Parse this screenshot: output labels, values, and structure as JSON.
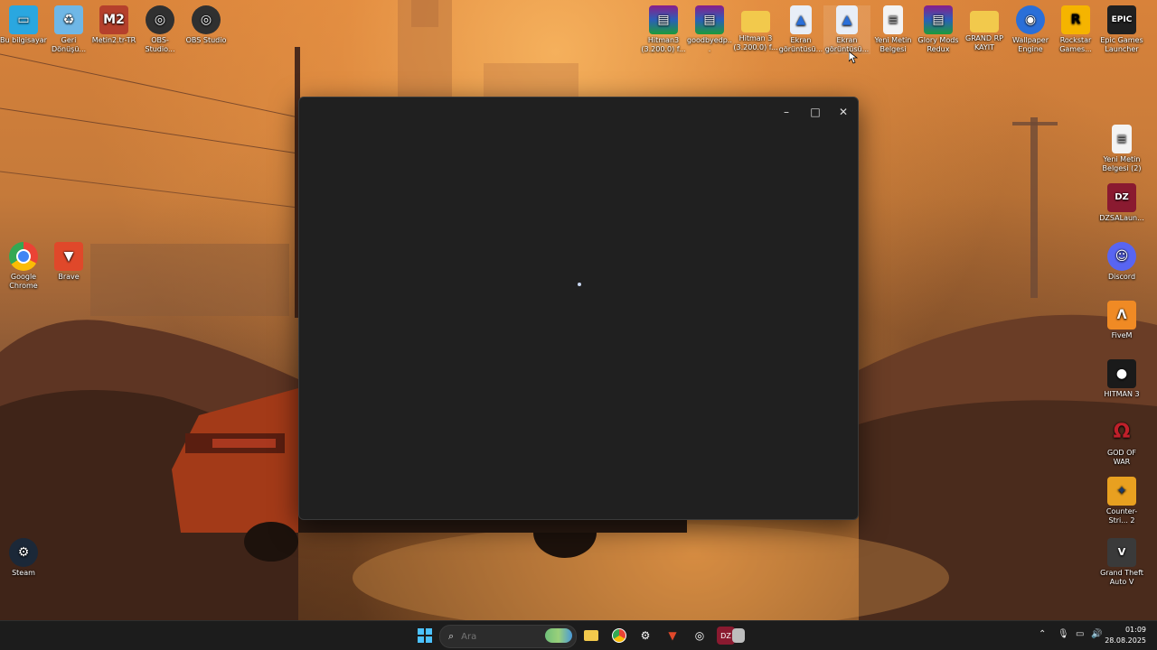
{
  "desktop": {
    "left_icons": [
      {
        "label": "Bu bilgisayar",
        "icon": "computer-icon",
        "color": "#2aa7e0"
      },
      {
        "label": "Geri Dönüşü...",
        "icon": "recycle-bin-icon",
        "color": "#6fb7e6"
      },
      {
        "label": "Metin2.tr-TR",
        "icon": "metin2-icon",
        "color": "#b5402c"
      },
      {
        "label": "OBS-Studio...",
        "icon": "obs-icon",
        "color": "#303030"
      },
      {
        "label": "OBS Studio",
        "icon": "obs-icon",
        "color": "#303030"
      },
      {
        "label": "Google Chrome",
        "icon": "chrome-icon",
        "color": "#ffffff"
      },
      {
        "label": "Brave",
        "icon": "brave-icon",
        "color": "#e0482a"
      },
      {
        "label": "Steam",
        "icon": "steam-icon",
        "color": "#1b2838"
      }
    ],
    "top_icons": [
      {
        "label": "Hitman3 (3.200.0) f...",
        "icon": "winrar-icon",
        "color": "#8a1e8a"
      },
      {
        "label": "goodbyedp...",
        "icon": "winrar-icon",
        "color": "#8a1e8a"
      },
      {
        "label": "Hitman 3 (3.200.0) f...",
        "icon": "folder-icon",
        "color": "#f2c94c"
      },
      {
        "label": "Ekran görüntüsü...",
        "icon": "image-file-icon",
        "color": "#e8eef7"
      },
      {
        "label": "Ekran görüntüsü...",
        "icon": "image-file-icon",
        "color": "#e8eef7"
      },
      {
        "label": "Yeni Metin Belgesi",
        "icon": "text-file-icon",
        "color": "#f3f3f3"
      },
      {
        "label": "Glory Mods Redux",
        "icon": "winrar-icon",
        "color": "#8a1e8a"
      },
      {
        "label": "GRAND RP KAYIT",
        "icon": "folder-icon",
        "color": "#f2c94c"
      },
      {
        "label": "Wallpaper Engine",
        "icon": "wallpaper-engine-icon",
        "color": "#2a6fd8"
      },
      {
        "label": "Rockstar Games...",
        "icon": "rockstar-icon",
        "color": "#f5b400"
      },
      {
        "label": "Epic Games Launcher",
        "icon": "epic-games-icon",
        "color": "#202020"
      }
    ],
    "right_icons": [
      {
        "label": "Yeni Metin Belgesi (2)",
        "icon": "text-file-icon",
        "color": "#f3f3f3"
      },
      {
        "label": "DZSALaun...",
        "icon": "dzsa-icon",
        "color": "#8a1a30"
      },
      {
        "label": "Discord",
        "icon": "discord-icon",
        "color": "#5865f2"
      },
      {
        "label": "FiveM",
        "icon": "fivem-icon",
        "color": "#f08a24"
      },
      {
        "label": "HITMAN 3",
        "icon": "hitman-icon",
        "color": "#1a1a1a"
      },
      {
        "label": "GOD OF WAR",
        "icon": "god-of-war-icon",
        "color": "#c0202a"
      },
      {
        "label": "Counter-Stri... 2",
        "icon": "counter-strike-icon",
        "color": "#e8a020"
      },
      {
        "label": "Grand Theft Auto V",
        "icon": "gta-icon",
        "color": "#3a3a3a"
      }
    ]
  },
  "window": {
    "minimize": "–",
    "maximize": "□",
    "close": "✕"
  },
  "taskbar": {
    "search_placeholder": "Ara",
    "date": "28.08.2025",
    "time": "01:09",
    "apps": [
      {
        "name": "windows-start-icon"
      },
      {
        "name": "widgets-icon"
      },
      {
        "name": "file-explorer-icon"
      },
      {
        "name": "chrome-icon"
      },
      {
        "name": "steam-icon"
      },
      {
        "name": "brave-icon"
      },
      {
        "name": "obs-icon"
      },
      {
        "name": "dzsa-icon"
      },
      {
        "name": "blank-window-icon"
      }
    ]
  }
}
